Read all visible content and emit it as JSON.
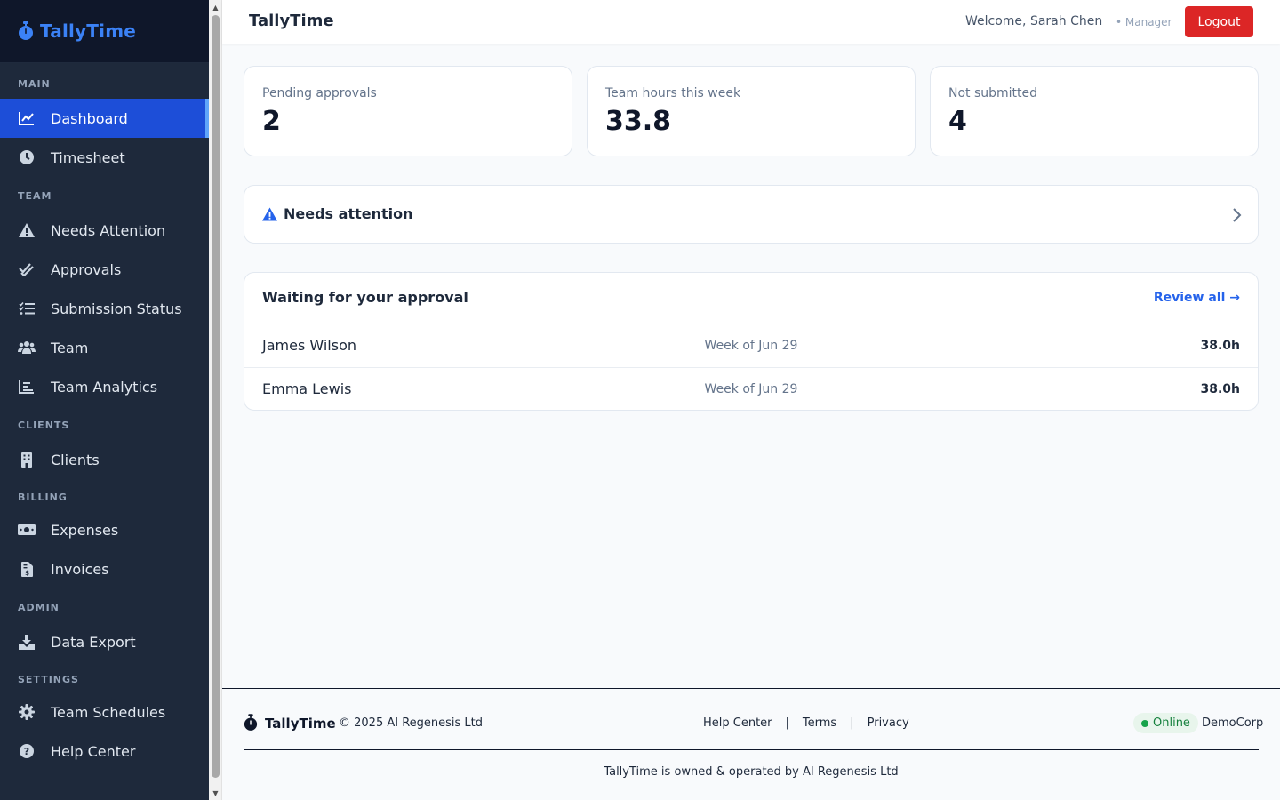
{
  "app": {
    "name": "TallyTime"
  },
  "sidebar": {
    "sections": {
      "main": "MAIN",
      "team": "TEAM",
      "clients": "CLIENTS",
      "billing": "BILLING",
      "admin": "ADMIN",
      "settings": "SETTINGS"
    },
    "items": {
      "dashboard": "Dashboard",
      "timesheet": "Timesheet",
      "needs_attention": "Needs Attention",
      "approvals": "Approvals",
      "submission_status": "Submission Status",
      "team": "Team",
      "team_analytics": "Team Analytics",
      "clients": "Clients",
      "expenses": "Expenses",
      "invoices": "Invoices",
      "data_export": "Data Export",
      "team_schedules": "Team Schedules",
      "help_center": "Help Center"
    },
    "active": "dashboard"
  },
  "header": {
    "title": "TallyTime",
    "welcome": "Welcome, Sarah Chen",
    "role": "• Manager",
    "logout_label": "Logout"
  },
  "stats": [
    {
      "label": "Pending approvals",
      "value": "2"
    },
    {
      "label": "Team hours this week",
      "value": "33.8"
    },
    {
      "label": "Not submitted",
      "value": "4"
    }
  ],
  "attention": {
    "title": "Needs attention"
  },
  "approvals": {
    "title": "Waiting for your approval",
    "review_all": "Review all →",
    "rows": [
      {
        "name": "James Wilson",
        "week": "Week of Jun 29",
        "hours": "38.0h"
      },
      {
        "name": "Emma Lewis",
        "week": "Week of Jun 29",
        "hours": "38.0h"
      }
    ]
  },
  "footer": {
    "brand": "TallyTime",
    "copyright": "© 2025 AI Regenesis Ltd",
    "links": [
      "Help Center",
      "Terms",
      "Privacy"
    ],
    "separator": "|",
    "status": "Online",
    "org": "DemoCorp",
    "owned": "TallyTime is owned & operated by AI Regenesis Ltd"
  },
  "colors": {
    "sidebar_bg": "#1e293b",
    "brand_blue": "#3b82f6",
    "active_item": "#1d4ed8",
    "logout_red": "#dc2626",
    "link_blue": "#2563eb",
    "online_green": "#16a34a"
  },
  "icons": {
    "brand": "stopwatch-icon",
    "dashboard": "chart-line-icon",
    "timesheet": "clock-icon",
    "needs_attention": "warning-triangle-icon",
    "approvals": "double-check-icon",
    "submission_status": "list-check-icon",
    "team": "users-icon",
    "team_analytics": "bar-chart-icon",
    "clients": "building-icon",
    "expenses": "money-bill-icon",
    "invoices": "invoice-icon",
    "data_export": "download-icon",
    "team_schedules": "gear-icon",
    "help_center": "question-circle-icon"
  }
}
